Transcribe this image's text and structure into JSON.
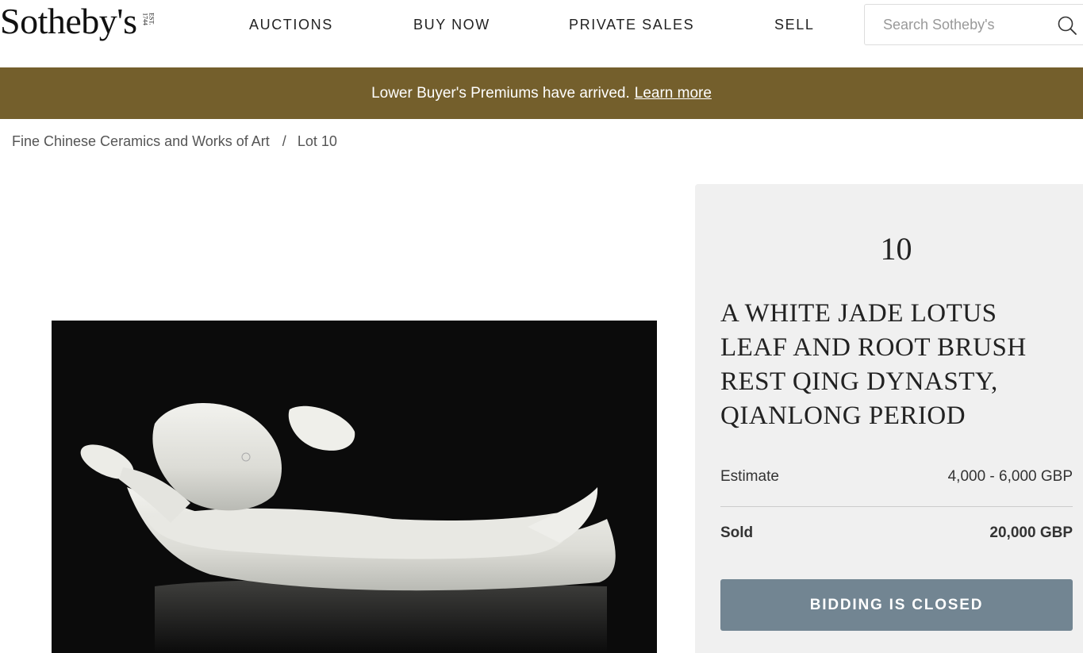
{
  "header": {
    "logo_text": "Sotheby's",
    "logo_est": [
      "EST.",
      "1744"
    ],
    "nav": {
      "auctions": "AUCTIONS",
      "buy_now": "BUY NOW",
      "private_sales": "PRIVATE SALES",
      "sell": "SELL"
    },
    "search": {
      "placeholder": "Search Sotheby's",
      "value": "",
      "icon": "search-icon"
    }
  },
  "banner": {
    "text": "Lower Buyer's Premiums have arrived.",
    "link": "Learn more",
    "color": "#745f2c"
  },
  "breadcrumb": {
    "items": [
      "Fine Chinese Ceramics and Works of Art",
      "Lot 10"
    ],
    "separator": "/"
  },
  "lot": {
    "image": "white jade lotus leaf and root brush rest on black background",
    "number": "10",
    "title": "A WHITE JADE LOTUS LEAF AND ROOT BRUSH REST QING DYNASTY, QIANLONG PERIOD",
    "estimate_label": "Estimate",
    "estimate_value": "4,000 - 6,000 GBP",
    "sold_label": "Sold",
    "sold_value": "20,000 GBP",
    "status_button": "BIDDING IS CLOSED",
    "status_button_color": "#728592"
  }
}
